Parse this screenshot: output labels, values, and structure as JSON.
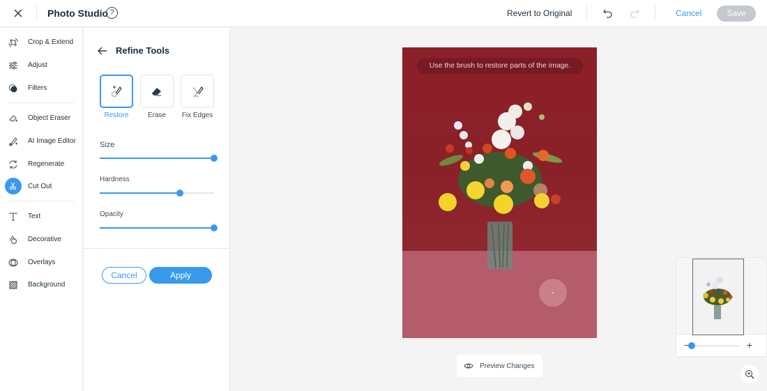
{
  "header": {
    "title": "Photo Studio",
    "help_glyph": "?",
    "revert_label": "Revert to Original",
    "cancel_label": "Cancel",
    "save_label": "Save",
    "icons": {
      "close": "close-icon",
      "help": "help-icon",
      "undo": "undo-icon",
      "redo": "redo-icon"
    }
  },
  "sidebar": {
    "items": [
      {
        "label": "Crop & Extend",
        "icon": "crop-rotate-icon"
      },
      {
        "label": "Adjust",
        "icon": "sliders-icon"
      },
      {
        "label": "Filters",
        "icon": "filters-icon"
      },
      {
        "label": "Object Eraser",
        "icon": "object-eraser-icon"
      },
      {
        "label": "AI Image Editor",
        "icon": "ai-brush-icon"
      },
      {
        "label": "Regenerate",
        "icon": "regenerate-icon"
      },
      {
        "label": "Cut Out",
        "icon": "scissors-icon",
        "active": true
      },
      {
        "label": "Text",
        "icon": "text-icon"
      },
      {
        "label": "Decorative",
        "icon": "shapes-icon"
      },
      {
        "label": "Overlays",
        "icon": "overlays-icon"
      },
      {
        "label": "Background",
        "icon": "background-icon"
      }
    ]
  },
  "refine": {
    "title": "Refine Tools",
    "tools": [
      {
        "label": "Restore",
        "icon": "restore-brush-icon",
        "selected": true
      },
      {
        "label": "Erase",
        "icon": "eraser-icon",
        "selected": false
      },
      {
        "label": "Fix Edges",
        "icon": "fix-edges-icon",
        "selected": false
      }
    ],
    "sliders": [
      {
        "label": "Size",
        "value_percent": 100
      },
      {
        "label": "Hardness",
        "value_percent": 70
      },
      {
        "label": "Opacity",
        "value_percent": 100
      }
    ],
    "cancel_label": "Cancel",
    "apply_label": "Apply"
  },
  "canvas": {
    "hint": "Use the brush to restore parts of the image.",
    "preview_label": "Preview Changes",
    "zoom_percent": 0,
    "colors": {
      "accent": "#3899ec",
      "wall": "#8a2129",
      "floor": "#b45c6b"
    }
  }
}
